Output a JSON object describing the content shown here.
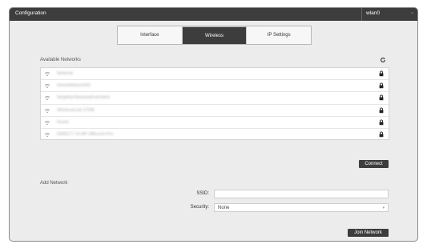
{
  "window": {
    "title": "Configuration",
    "interface": "wlan0"
  },
  "tabs": [
    {
      "label": "Interface",
      "active": false
    },
    {
      "label": "Wireless",
      "active": true
    },
    {
      "label": "IP Settings",
      "active": false
    }
  ],
  "available_networks": {
    "label": "Available Networks",
    "networks": [
      {
        "name": "Network",
        "secured": true
      },
      {
        "name": "HomeNetwork5G",
        "secured": true
      },
      {
        "name": "NeighborNetworkExtended",
        "secured": true
      },
      {
        "name": "WirelessLink-27DB",
        "secured": true
      },
      {
        "name": "Guest",
        "secured": true
      },
      {
        "name": "DIRECT-74-HP OfficeJet Pro",
        "secured": true
      }
    ],
    "connect_label": "Connect"
  },
  "add_network": {
    "label": "Add Network",
    "ssid_label": "SSID:",
    "ssid_value": "",
    "security_label": "Security:",
    "security_value": "None",
    "join_label": "Join Network"
  },
  "colors": {
    "dark": "#3d3d3d",
    "background": "#ececec"
  }
}
